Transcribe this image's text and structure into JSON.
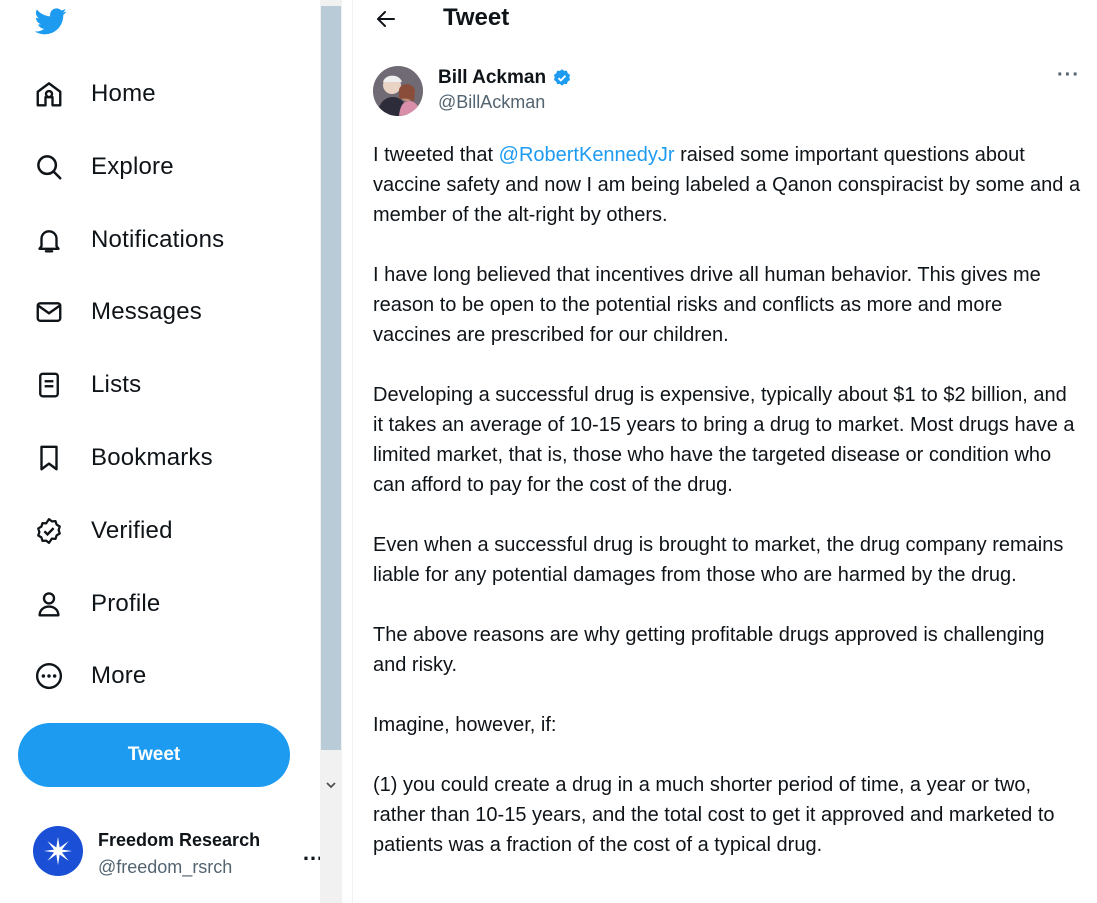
{
  "sidebar": {
    "logo": "twitter-bird-icon",
    "brand_color": "#1d9bf0",
    "nav": [
      {
        "label": "Home",
        "icon": "home-icon"
      },
      {
        "label": "Explore",
        "icon": "search-icon"
      },
      {
        "label": "Notifications",
        "icon": "bell-icon"
      },
      {
        "label": "Messages",
        "icon": "envelope-icon"
      },
      {
        "label": "Lists",
        "icon": "list-icon"
      },
      {
        "label": "Bookmarks",
        "icon": "bookmark-icon"
      },
      {
        "label": "Verified",
        "icon": "verified-badge-icon"
      },
      {
        "label": "Profile",
        "icon": "person-icon"
      },
      {
        "label": "More",
        "icon": "more-circle-icon"
      }
    ],
    "tweet_button": "Tweet",
    "account": {
      "name": "Freedom Research",
      "handle": "@freedom_rsrch",
      "more": "…"
    }
  },
  "header": {
    "title": "Tweet",
    "back_icon": "arrow-left-icon"
  },
  "tweet": {
    "author_name": "Bill Ackman",
    "author_handle": "@BillAckman",
    "verified_color": "#1d9bf0",
    "more": "···",
    "p1_before": "I tweeted that ",
    "p1_mention": "@RobertKennedyJr",
    "p1_after": " raised some important questions about vaccine safety and now I am being labeled a Qanon conspiracist by some and a member of the alt-right by others.",
    "p2": "I have long believed that incentives drive all human behavior. This gives me reason to be open to the potential risks and conflicts as more and more vaccines are prescribed for our children.",
    "p3": "Developing a successful drug is expensive, typically about $1 to $2 billion, and it takes an average of 10-15 years to bring a drug to market. Most drugs have a limited market, that is, those who have the targeted disease or condition who can afford to pay for the cost of the drug.",
    "p4": "Even when a successful drug is brought to market, the drug company remains liable for any potential damages from those who are harmed by the drug.",
    "p5": "The above reasons are why getting profitable drugs approved is challenging and risky.",
    "p6": "Imagine, however, if:",
    "p7": "(1) you could create a drug in a much shorter period of time, a year or two, rather than 10-15 years, and the total cost to get it approved and marketed to patients was a fraction of the cost of a typical drug."
  }
}
